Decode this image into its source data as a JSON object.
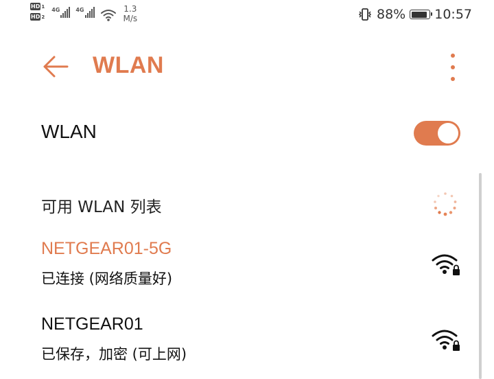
{
  "status_bar": {
    "sim1_badge": "HD",
    "sim1_index": "1",
    "sim2_badge": "HD",
    "sim2_index": "2",
    "signal1_label": "4G",
    "signal2_label": "4G",
    "speed_value": "1.3",
    "speed_unit": "M/s",
    "battery_percent": "88%",
    "battery_level": 0.88,
    "time": "10:57"
  },
  "app_bar": {
    "back_icon": "arrow-left-icon",
    "title": "WLAN",
    "more_icon": "more-vertical-icon"
  },
  "wlan_toggle": {
    "label": "WLAN",
    "on": true
  },
  "available_list": {
    "header": "可用 WLAN 列表",
    "networks": [
      {
        "name": "NETGEAR01-5G",
        "status": "已连接 (网络质量好)",
        "icon": "wifi-lock-icon",
        "connected": true
      },
      {
        "name": "NETGEAR01",
        "status": "已保存，加密 (可上网)",
        "icon": "wifi-lock-icon",
        "connected": false
      }
    ]
  },
  "colors": {
    "accent": "#E07B4F",
    "text": "#111111",
    "background": "#FFFFFF"
  }
}
